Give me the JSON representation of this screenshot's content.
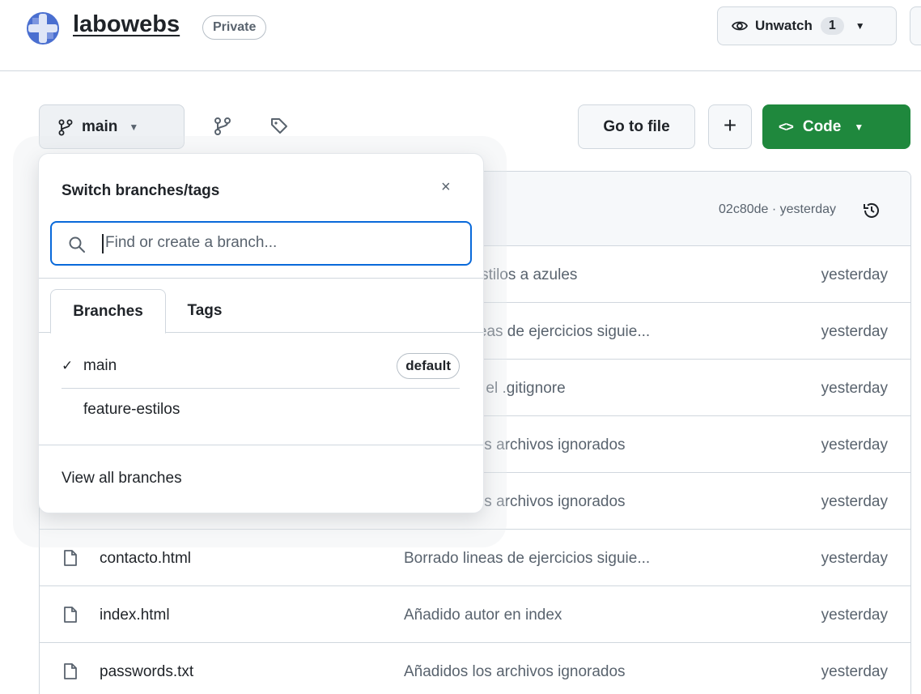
{
  "header": {
    "repo_name": "labowebs",
    "visibility_badge": "Private",
    "unwatch_label": "Unwatch",
    "watch_count": "1"
  },
  "toolbar": {
    "branch": "main",
    "goto_file_label": "Go to file",
    "add_label": "+",
    "code_label": "Code"
  },
  "commit_bar": {
    "meta": "02c80de · yesterday"
  },
  "files": [
    {
      "name": "",
      "message": "Añadidos estilos a azules",
      "date": "yesterday"
    },
    {
      "name": "",
      "message": "Borrado lineas de ejercicios siguie...",
      "date": "yesterday"
    },
    {
      "name": "",
      "message": "Añadido en el .gitignore",
      "date": "yesterday"
    },
    {
      "name": "",
      "message": "Añadidos los archivos ignorados",
      "date": "yesterday"
    },
    {
      "name": "",
      "message": "Añadidos los archivos ignorados",
      "date": "yesterday"
    },
    {
      "name": "contacto.html",
      "message": "Borrado lineas de ejercicios siguie...",
      "date": "yesterday"
    },
    {
      "name": "index.html",
      "message": "Añadido autor en index",
      "date": "yesterday"
    },
    {
      "name": "passwords.txt",
      "message": "Añadidos los archivos ignorados",
      "date": "yesterday"
    }
  ],
  "dropdown": {
    "title": "Switch branches/tags",
    "close": "×",
    "search_placeholder": "Find or create a branch...",
    "tabs": [
      "Branches",
      "Tags"
    ],
    "branches": [
      {
        "check": "✓",
        "name": "main",
        "badge": "default"
      },
      {
        "check": "",
        "name": "feature-estilos",
        "badge": ""
      }
    ],
    "view_all": "View all branches"
  },
  "colors": {
    "accent": "#0969da",
    "code_button": "#1f883d",
    "border": "#d0d7de"
  }
}
